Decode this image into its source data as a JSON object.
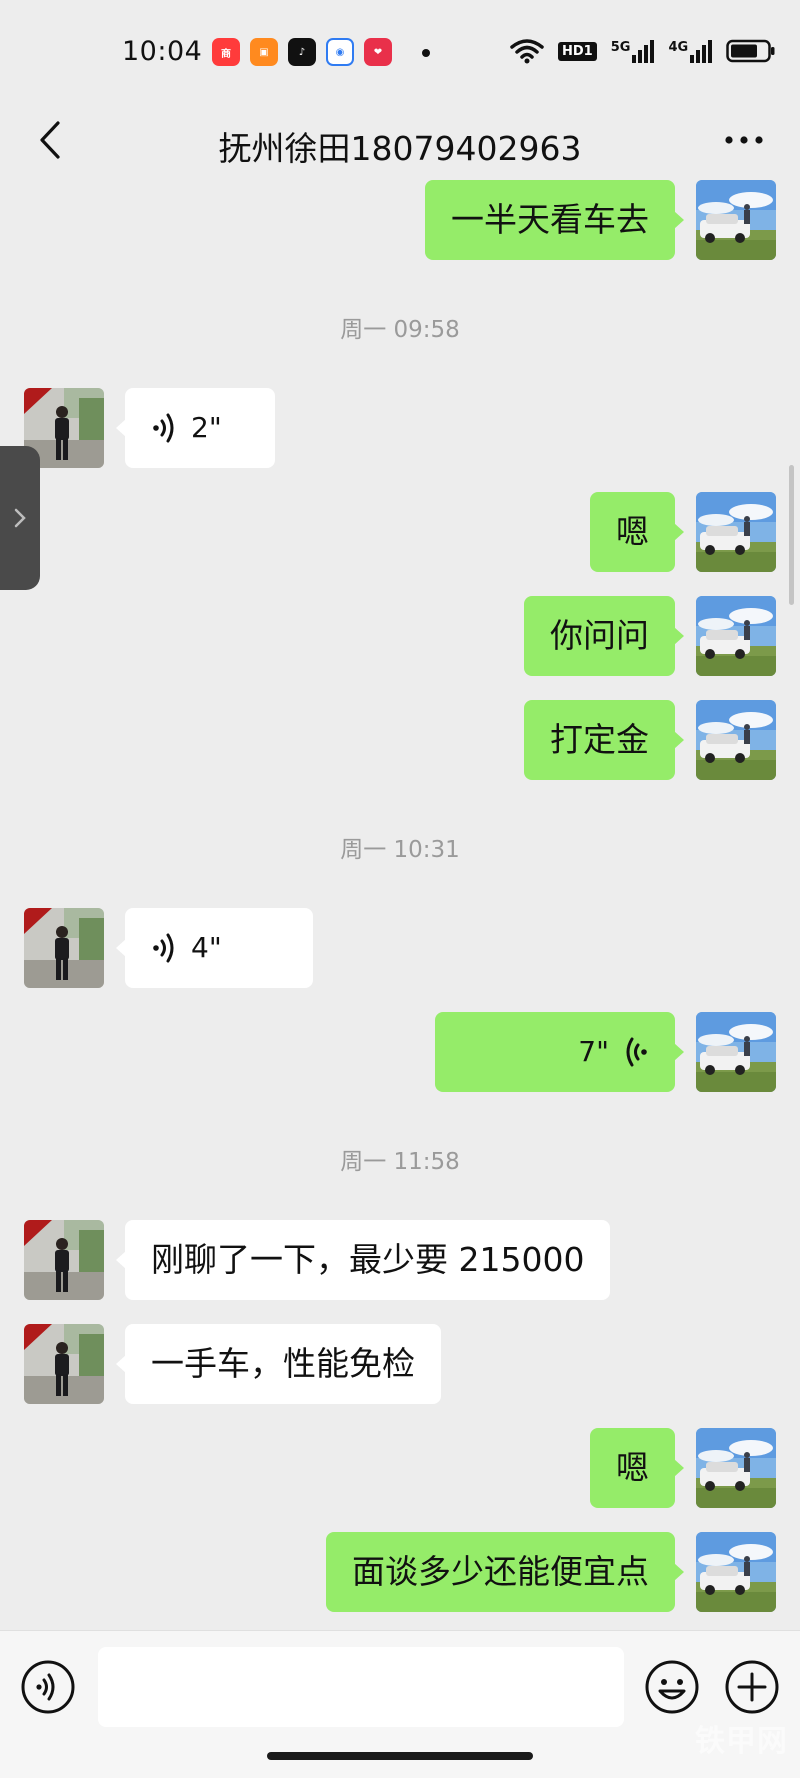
{
  "status_bar": {
    "time": "10:04",
    "apps": [
      {
        "name": "app-icon-red",
        "color": "#ff3b3b",
        "glyph": "商"
      },
      {
        "name": "app-icon-orange",
        "color": "#ff8a1f",
        "glyph": "▣"
      },
      {
        "name": "tiktok-icon",
        "color": "#111111",
        "glyph": "♪"
      },
      {
        "name": "app-icon-blue",
        "color": "#2f7bf2",
        "glyph": "◉"
      },
      {
        "name": "app-icon-pink",
        "color": "#e9304a",
        "glyph": "❤"
      }
    ],
    "hd_label": "HD1",
    "net1": "5G",
    "net2": "4G"
  },
  "header": {
    "title": "抚州徐田18079402963"
  },
  "messages": [
    {
      "kind": "text",
      "dir": "out",
      "text": "一半天看车去"
    },
    {
      "kind": "time",
      "text": "周一 09:58"
    },
    {
      "kind": "voice",
      "dir": "in",
      "duration": "2\""
    },
    {
      "kind": "text",
      "dir": "out",
      "text": "嗯"
    },
    {
      "kind": "text",
      "dir": "out",
      "text": "你问问"
    },
    {
      "kind": "text",
      "dir": "out",
      "text": "打定金"
    },
    {
      "kind": "time",
      "text": "周一 10:31"
    },
    {
      "kind": "voice",
      "dir": "in",
      "duration": "4\""
    },
    {
      "kind": "voice",
      "dir": "out",
      "duration": "7\""
    },
    {
      "kind": "time",
      "text": "周一 11:58"
    },
    {
      "kind": "text",
      "dir": "in",
      "text": "刚聊了一下，最少要 215000"
    },
    {
      "kind": "text",
      "dir": "in",
      "text": "一手车，性能免检"
    },
    {
      "kind": "text",
      "dir": "out",
      "text": "嗯"
    },
    {
      "kind": "text",
      "dir": "out",
      "text": "面谈多少还能便宜点"
    },
    {
      "kind": "emoji",
      "dir": "out",
      "text": "😂"
    }
  ],
  "input": {
    "value": "",
    "placeholder": ""
  },
  "watermark": "铁甲网",
  "colors": {
    "background": "#ededed",
    "outgoing_bubble": "#95ec69",
    "incoming_bubble": "#ffffff",
    "timestamp_text": "#9a9a9a"
  }
}
